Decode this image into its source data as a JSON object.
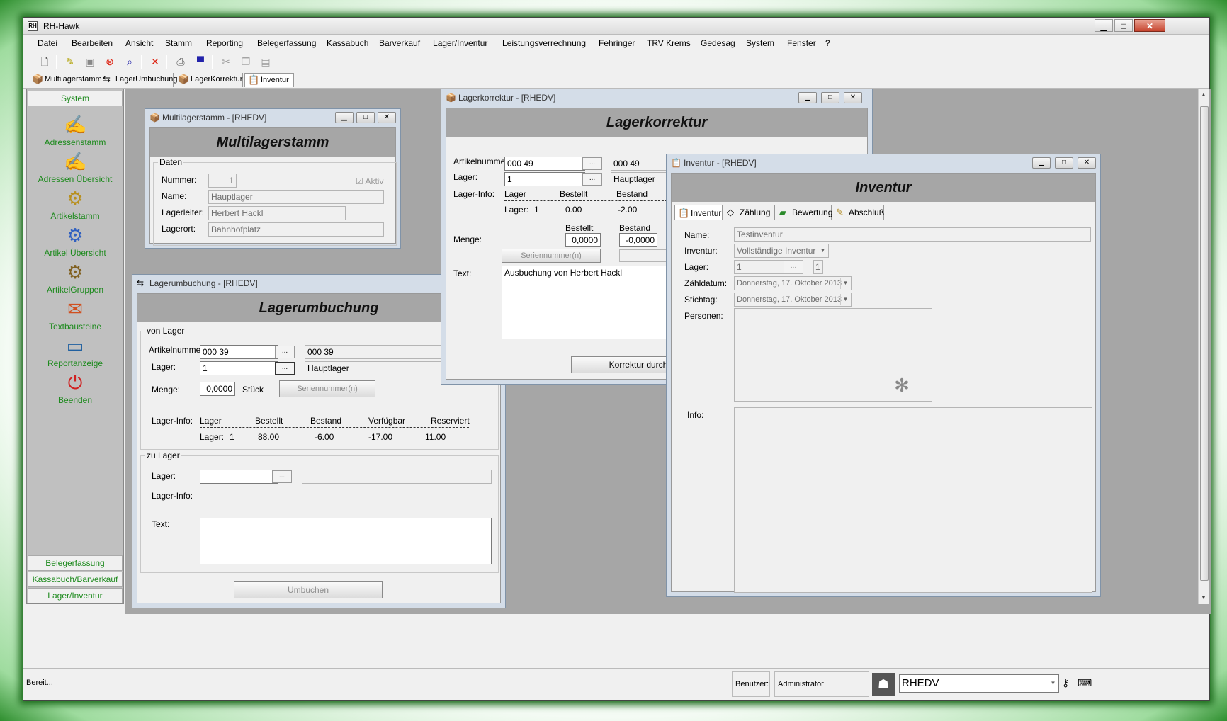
{
  "app": {
    "title": "RH-Hawk",
    "icon_text": "RH",
    "caption_buttons": {
      "minimize": "▁",
      "maximize": "□",
      "close": "✕"
    }
  },
  "menu": [
    "Datei",
    "Bearbeiten",
    "Ansicht",
    "Stamm",
    "Reporting",
    "Belegerfassung",
    "Kassabuch",
    "Barverkauf",
    "Lager/Inventur",
    "Leistungsverrechnung",
    "Fehringer",
    "TRV Krems",
    "Gedesag",
    "System",
    "Fenster",
    "?"
  ],
  "toolbar": {
    "new_icon": "new-document-icon",
    "check_icon": "check-icon",
    "save_icon": "save-icon",
    "cancel_icon": "cancel-icon",
    "search_icon": "search-icon",
    "delete_icon": "delete-icon",
    "print_icon": "print-icon",
    "preview_icon": "preview-icon",
    "cut_icon": "cut-icon",
    "copy_icon": "copy-icon",
    "paste_icon": "paste-icon"
  },
  "tasks": [
    "Multilagerstamm",
    "LagerUmbuchung",
    "LagerKorrektur",
    "Inventur"
  ],
  "nav": {
    "header": "System",
    "items": [
      "Adressenstamm",
      "Adressen Übersicht",
      "Artikelstamm",
      "Artikel Übersicht",
      "ArtikelGruppen",
      "Textbausteine",
      "Reportanzeige",
      "Beenden"
    ],
    "footer": [
      "Belegerfassung",
      "Kassabuch/Barverkauf",
      "Lager/Inventur"
    ]
  },
  "multilager": {
    "window_title": "Multilagerstamm - [RHEDV]",
    "heading": "Multilagerstamm",
    "group": "Daten",
    "nummer_label": "Nummer:",
    "nummer_value": "1",
    "aktiv_label": "Aktiv",
    "name_label": "Name:",
    "name_value": "Hauptlager",
    "lagerleiter_label": "Lagerleiter:",
    "lagerleiter_value": "Herbert Hackl",
    "lagerort_label": "Lagerort:",
    "lagerort_value": "Bahnhofplatz"
  },
  "umbuchung": {
    "window_title": "Lagerumbuchung - [RHEDV]",
    "heading": "Lagerumbuchung",
    "von_group": "von Lager",
    "artikel_label": "Artikelnummer:",
    "artikel_value": "000 39",
    "artikel_desc": "000 39",
    "lager_label": "Lager:",
    "lager_value": "1",
    "lager_desc": "Hauptlager",
    "menge_label": "Menge:",
    "menge_value": "0,0000",
    "menge_unit": "Stück",
    "serien_button": "Seriennummer(n)",
    "info_label": "Lager-Info:",
    "info_headers": [
      "Lager",
      "Bestellt",
      "Bestand",
      "Verfügbar",
      "Reserviert"
    ],
    "info_row": [
      "Lager:",
      "1",
      "88.00",
      "-6.00",
      "-17.00",
      "11.00"
    ],
    "zu_group": "zu Lager",
    "zu_lager_label": "Lager:",
    "zu_info_label": "Lager-Info:",
    "text_label": "Text:",
    "umbuchen_button": "Umbuchen"
  },
  "korrektur": {
    "window_title": "Lagerkorrektur - [RHEDV]",
    "heading": "Lagerkorrektur",
    "artikel_label": "Artikelnummer:",
    "artikel_value": "000 49",
    "artikel_desc": "000 49",
    "lager_label": "Lager:",
    "lager_value": "1",
    "lager_desc": "Hauptlager",
    "info_label": "Lager-Info:",
    "info_headers": [
      "Lager",
      "Bestellt",
      "Bestand"
    ],
    "info_row": [
      "Lager:",
      "1",
      "0.00",
      "-2.00"
    ],
    "menge_label": "Menge:",
    "bestellt_label": "Bestellt",
    "bestand_label": "Bestand",
    "bestellt_value": "0,0000",
    "bestand_value": "-0,0000",
    "serien_button": "Seriennummer(n)",
    "text_label": "Text:",
    "text_value": "Ausbuchung von Herbert Hackl",
    "korrektur_button": "Korrektur durchfü"
  },
  "inventur": {
    "window_title": "Inventur - [RHEDV]",
    "heading": "Inventur",
    "tabs": [
      "Inventur",
      "Zählung",
      "Bewertung",
      "Abschluß"
    ],
    "name_label": "Name:",
    "name_value": "Testinventur",
    "inventur_label": "Inventur:",
    "inventur_value": "Vollständige Inventur",
    "lager_label": "Lager:",
    "lager_value": "1",
    "lager_desc": "1",
    "zaehl_label": "Zähldatum:",
    "zaehl_value": "Donnerstag, 17.  Oktober  2013",
    "stich_label": "Stichtag:",
    "stich_value": "Donnerstag, 17.  Oktober  2013",
    "personen_label": "Personen:",
    "info_label": "Info:"
  },
  "status": {
    "text": "Bereit...",
    "benutzer_label": "Benutzer:",
    "benutzer_value": "Administrator",
    "mandant": "RHEDV"
  }
}
